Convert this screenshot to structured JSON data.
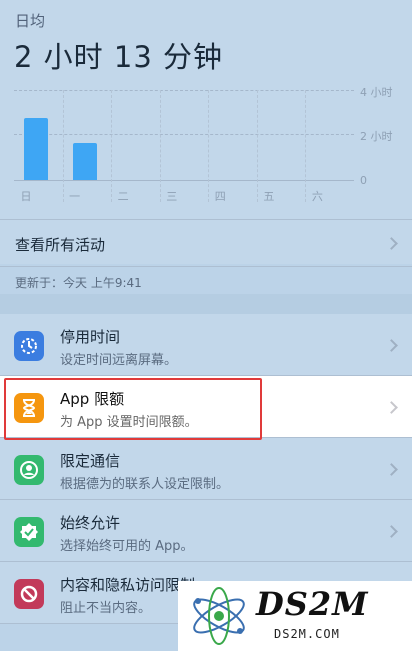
{
  "summary": {
    "avg_label": "日均",
    "avg_value": "2 小时 13 分钟",
    "see_all": "查看所有活动",
    "updated": "更新于：今天 上午9:41"
  },
  "chart_data": {
    "type": "bar",
    "categories": [
      "日",
      "一",
      "二",
      "三",
      "四",
      "五",
      "六"
    ],
    "values": [
      2.75,
      1.65,
      0,
      0,
      0,
      0,
      0
    ],
    "y_ticks": [
      "4 小时",
      "2 小时",
      "0"
    ],
    "ylim": [
      0,
      4
    ],
    "bar_color": "#3ea6f4"
  },
  "items": [
    {
      "title": "停用时间",
      "sub": "设定时间远离屏幕。",
      "icon": "downtime-icon",
      "color": "#3b7de0"
    },
    {
      "title": "App 限额",
      "sub": "为 App 设置时间限额。",
      "icon": "hourglass-icon",
      "color": "#f5960f"
    },
    {
      "title": "限定通信",
      "sub": "根据德为的联系人设定限制。",
      "icon": "contact-icon",
      "color": "#33b96f"
    },
    {
      "title": "始终允许",
      "sub": "选择始终可用的 App。",
      "icon": "checkmark-badge-icon",
      "color": "#33b96f"
    },
    {
      "title": "内容和隐私访问限制",
      "sub": "阻止不当内容。",
      "icon": "restriction-icon",
      "color": "#c23a5a"
    }
  ],
  "watermark": {
    "big": "DS2M",
    "small": "DS2M.COM"
  }
}
